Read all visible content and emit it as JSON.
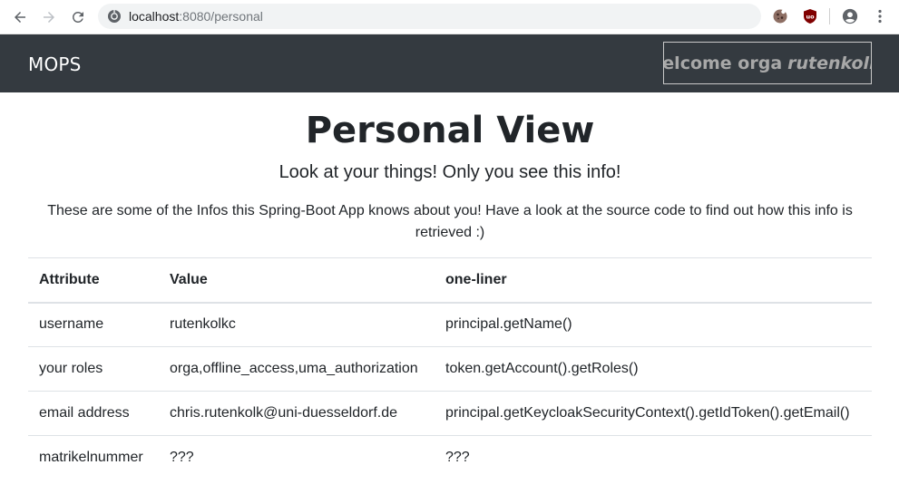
{
  "browser": {
    "url_host": "localhost",
    "url_rest": ":8080/personal",
    "icons": [
      "back-icon",
      "forward-icon",
      "reload-icon",
      "site-info-icon",
      "cookie-extension-icon",
      "ublock-icon",
      "profile-icon",
      "menu-icon"
    ]
  },
  "navbar": {
    "brand": "MOPS",
    "welcome_prefix": "Welcome orga",
    "username": "rutenkolkc",
    "background": "#343a40"
  },
  "page": {
    "title": "Personal View",
    "subtitle": "Look at your things! Only you see this info!",
    "intro": "These are some of the Infos this Spring-Boot App knows about you! Have a look at the source code to find out how this info is retrieved :)"
  },
  "table": {
    "headers": [
      "Attribute",
      "Value",
      "one-liner"
    ],
    "rows": [
      [
        "username",
        "rutenkolkc",
        "principal.getName()"
      ],
      [
        "your roles",
        "orga,offline_access,uma_authorization",
        "token.getAccount().getRoles()"
      ],
      [
        "email address",
        "chris.rutenkolk@uni-duesseldorf.de",
        "principal.getKeycloakSecurityContext().getIdToken().getEmail()"
      ],
      [
        "matrikelnummer",
        "???",
        "???"
      ]
    ]
  }
}
